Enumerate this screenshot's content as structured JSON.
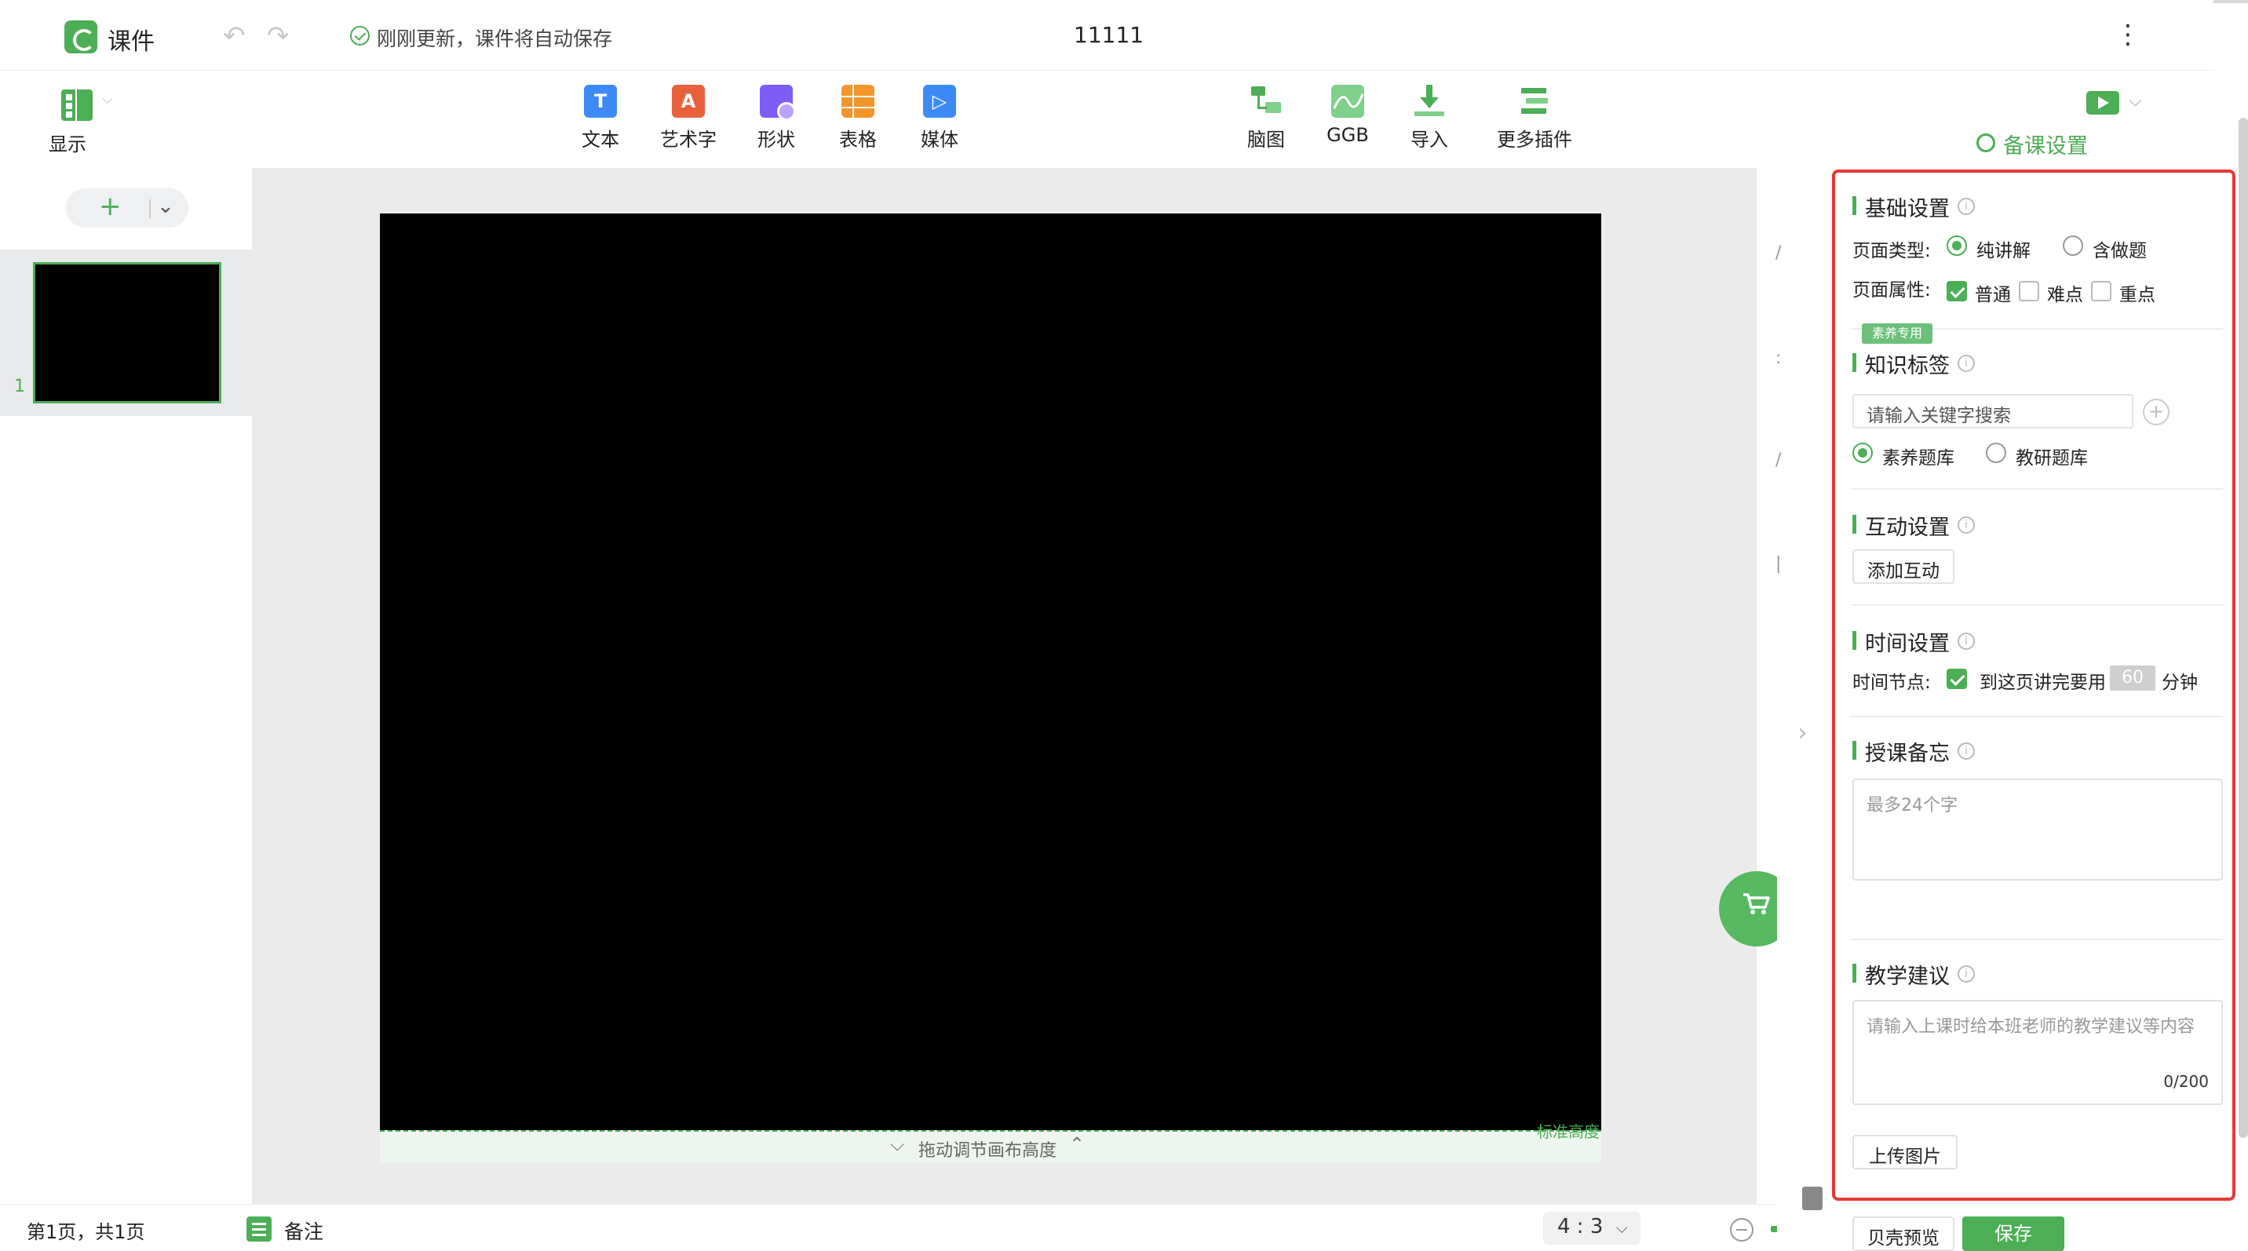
{
  "app": {
    "name": "课件",
    "save_status": "刚刚更新，课件将自动保存",
    "doc_title": "11111"
  },
  "toolbar": {
    "display": "显示",
    "insert": [
      {
        "label": "文本",
        "icon": "text-icon",
        "glyph": "T",
        "color": "#3d8af7"
      },
      {
        "label": "艺术字",
        "icon": "art-text-icon",
        "glyph": "A",
        "color": "#e8613c"
      },
      {
        "label": "形状",
        "icon": "shape-icon",
        "glyph": "",
        "color": "#7c5cf5"
      },
      {
        "label": "表格",
        "icon": "table-icon",
        "glyph": "",
        "color": "#f3952b"
      },
      {
        "label": "媒体",
        "icon": "media-icon",
        "glyph": "▷",
        "color": "#3d8af7"
      }
    ],
    "plugins": [
      {
        "label": "脑图",
        "icon": "mindmap-icon"
      },
      {
        "label": "GGB",
        "icon": "ggb-icon"
      },
      {
        "label": "导入",
        "icon": "import-icon"
      },
      {
        "label": "更多插件",
        "icon": "more-plugins-icon"
      }
    ],
    "plugin_color": "#4cae55"
  },
  "slides": {
    "current_number": "1",
    "add_glyph": "+"
  },
  "canvas": {
    "resize_hint": "拖动调节画布高度",
    "standard_height": "标准高度"
  },
  "status_bar": {
    "page_info": "第1页，共1页",
    "notes": "备注",
    "ratio": "4 : 3"
  },
  "panel": {
    "title": "备课设置",
    "basic": {
      "title": "基础设置",
      "page_type_label": "页面类型:",
      "page_type_options": [
        "纯讲解",
        "含做题"
      ],
      "page_type_selected": "纯讲解",
      "page_attr_label": "页面属性:",
      "page_attr_options": [
        "普通",
        "难点",
        "重点"
      ],
      "page_attr_checked": [
        "普通"
      ]
    },
    "knowledge": {
      "badge": "素养专用",
      "title": "知识标签",
      "search_placeholder": "请输入关键字搜索",
      "bank_options": [
        "素养题库",
        "教研题库"
      ],
      "bank_selected": "素养题库"
    },
    "interaction": {
      "title": "互动设置",
      "add_button": "添加互动"
    },
    "time": {
      "title": "时间设置",
      "node_label": "时间节点:",
      "checkbox_label": "到这页讲完要用",
      "minutes": "60",
      "unit": "分钟"
    },
    "memo": {
      "title": "授课备忘",
      "placeholder": "最多24个字"
    },
    "advice": {
      "title": "教学建议",
      "placeholder": "请输入上课时给本班老师的教学建议等内容",
      "counter": "0/200",
      "upload_button": "上传图片"
    },
    "footer": {
      "preview_button": "贝壳预览",
      "save_button": "保存"
    }
  },
  "colors": {
    "accent": "#4cae55",
    "highlight_frame": "#e53935"
  }
}
